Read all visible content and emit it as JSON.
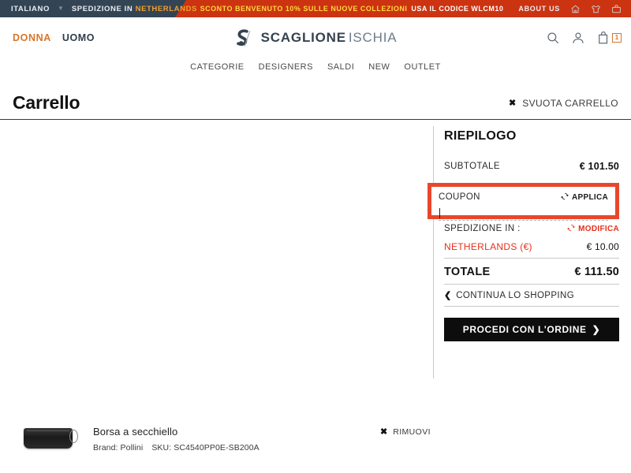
{
  "topbar": {
    "language": "ITALIANO",
    "caret_icon": "chevron-down-icon",
    "shipping_prefix": "SPEDIZIONE IN",
    "shipping_country": "NETHERLANDS",
    "promo_main": "SCONTO BENVENUTO 10% SULLE NUOVE COLLEZIONI",
    "promo_code_text": "USA IL CODICE WLCM10",
    "about": "ABOUT US",
    "icons": [
      "home-icon",
      "tshirt-icon",
      "bag-icon"
    ],
    "bg_color": "#334455",
    "promo_color": "#cc3311",
    "promo_highlight_color": "#ffd83d",
    "country_color": "#f0a030"
  },
  "header": {
    "gender_women": "DONNA",
    "gender_men": "UOMO",
    "gender_women_color": "#d9752a",
    "logo_bold": "SCAGLIONE",
    "logo_light": "ISCHIA",
    "search_icon": "search-icon",
    "account_icon": "user-icon",
    "cart_icon": "shopping-bag-icon",
    "cart_count": "1",
    "cart_badge_color": "#d9752a"
  },
  "nav": {
    "items": [
      {
        "label": "CATEGORIE"
      },
      {
        "label": "DESIGNERS"
      },
      {
        "label": "SALDI"
      },
      {
        "label": "NEW"
      },
      {
        "label": "OUTLET"
      }
    ]
  },
  "page": {
    "title": "Carrello",
    "empty_cart_label": "SVUOTA CARRELLO",
    "empty_cart_icon": "close-x-icon"
  },
  "summary": {
    "title": "RIEPILOGO",
    "subtotal_label": "SUBTOTALE",
    "subtotal_value": "€ 101.50",
    "coupon_label": "COUPON",
    "coupon_apply_label": "APPLICA",
    "coupon_apply_icon": "refresh-icon",
    "coupon_value": "",
    "coupon_placeholder": "",
    "coupon_highlight_color": "#e8472b",
    "shipping_label": "SPEDIZIONE IN :",
    "shipping_edit_label": "MODIFICA",
    "shipping_edit_icon": "refresh-icon",
    "shipping_country": "NETHERLANDS (€)",
    "shipping_cost": "€ 10.00",
    "shipping_accent_color": "#e8301a",
    "total_label": "TOTALE",
    "total_value": "€ 111.50",
    "continue_label": "CONTINUA LO SHOPPING",
    "continue_icon": "chevron-left-icon",
    "checkout_label": "PROCEDI CON L'ORDINE",
    "checkout_icon": "chevron-right-icon",
    "checkout_bg_color": "#0d0d0d"
  },
  "product": {
    "thumb_icon": "product-bag-thumbnail",
    "name": "Borsa a secchiello",
    "brand_label": "Brand: Pollini",
    "sku_label": "SKU: SC4540PP0E-SB200A",
    "remove_label": "RIMUOVI",
    "remove_icon": "close-x-icon"
  }
}
